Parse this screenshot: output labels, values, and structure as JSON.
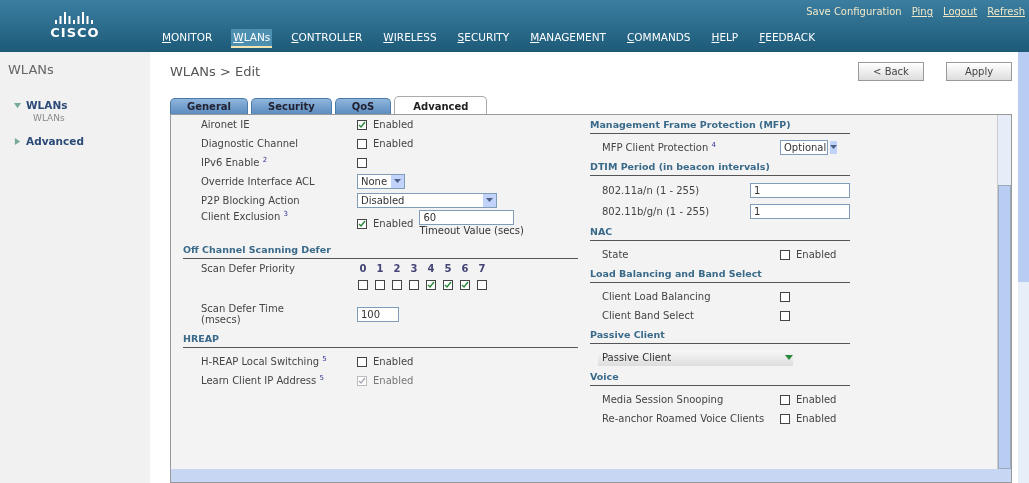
{
  "header": {
    "logo": "CISCO",
    "links": [
      "Save Configuration",
      "Ping",
      "Logout",
      "Refresh"
    ],
    "menu": [
      {
        "label": "MONITOR",
        "selected": false
      },
      {
        "label": "WLANs",
        "selected": true
      },
      {
        "label": "CONTROLLER",
        "selected": false
      },
      {
        "label": "WIRELESS",
        "selected": false
      },
      {
        "label": "SECURITY",
        "selected": false
      },
      {
        "label": "MANAGEMENT",
        "selected": false
      },
      {
        "label": "COMMANDS",
        "selected": false
      },
      {
        "label": "HELP",
        "selected": false
      },
      {
        "label": "FEEDBACK",
        "selected": false
      }
    ]
  },
  "sidebar": {
    "title": "WLANs",
    "items": [
      {
        "label": "WLANs",
        "expanded": true,
        "children": [
          {
            "label": "WLANs"
          }
        ]
      },
      {
        "label": "Advanced",
        "expanded": false
      }
    ]
  },
  "page": {
    "title": "WLANs > Edit",
    "buttons": [
      "< Back",
      "Apply"
    ]
  },
  "tabs": [
    {
      "label": "General",
      "selected": false
    },
    {
      "label": "Security",
      "selected": false
    },
    {
      "label": "QoS",
      "selected": false
    },
    {
      "label": "Advanced",
      "selected": true
    }
  ],
  "left_column": [
    {
      "rows": [
        {
          "kind": "check",
          "label": "Aironet IE",
          "checked": true,
          "disabled": false,
          "text": "Enabled"
        },
        {
          "kind": "check",
          "label": "Diagnostic Channel",
          "checked": false,
          "disabled": false,
          "text": "Enabled"
        },
        {
          "kind": "check",
          "label": "IPv6 Enable $^{2}$",
          "checked": false,
          "disabled": false
        },
        {
          "kind": "select",
          "label": "Override Interface ACL",
          "value": "None"
        },
        {
          "kind": "select",
          "label": "P2P Blocking Action",
          "value": "Disabled",
          "wide": true
        },
        {
          "kind": "timeout",
          "label": "Client Exclusion $^{3}$",
          "checked": true,
          "text": "Enabled",
          "value": "60",
          "hint": "Timeout Value (secs)"
        }
      ]
    },
    {
      "title": "Off Channel Scanning Defer",
      "rows": [
        {
          "kind": "priority",
          "label": "Scan Defer Priority",
          "levels": [
            {
              "label": "0",
              "checked": false
            },
            {
              "label": "1",
              "checked": false
            },
            {
              "label": "2",
              "checked": false
            },
            {
              "label": "3",
              "checked": false
            },
            {
              "label": "4",
              "checked": true
            },
            {
              "label": "5",
              "checked": true
            },
            {
              "label": "6",
              "checked": true
            },
            {
              "label": "7",
              "checked": false
            }
          ]
        },
        {
          "kind": "input",
          "label": "Scan Defer Time",
          "sublabel": "(msecs)",
          "value": "100"
        }
      ]
    },
    {
      "title": "HREAP",
      "rows": [
        {
          "kind": "check",
          "label": "H-REAP Local Switching $^{5}$",
          "checked": false,
          "disabled": false,
          "text": "Enabled"
        },
        {
          "kind": "check",
          "label": "Learn Client IP Address $^{5}$",
          "checked": true,
          "disabled": true,
          "text": "Enabled"
        }
      ]
    }
  ],
  "right_column": [
    {
      "title": "Management Frame Protection (MFP)",
      "rows": [
        {
          "kind": "select",
          "label": "MFP Client Protection $^{4}$",
          "value": "Optional"
        }
      ]
    },
    {
      "title": "DTIM Period (in beacon intervals)",
      "rows": [
        {
          "kind": "input",
          "label": "802.11a/n (1 - 255)",
          "value": "1"
        },
        {
          "kind": "input",
          "label": "802.11b/g/n (1 - 255)",
          "value": "1"
        }
      ]
    },
    {
      "title": "NAC",
      "rows": [
        {
          "kind": "check",
          "label": "State",
          "checked": false,
          "disabled": false,
          "text": "Enabled"
        }
      ]
    },
    {
      "title": "Load Balancing and Band Select",
      "rows": [
        {
          "kind": "check",
          "label": "Client Load Balancing",
          "checked": false,
          "disabled": false
        },
        {
          "kind": "check",
          "label": "Client Band Select",
          "checked": false,
          "disabled": false
        }
      ]
    },
    {
      "title": "Passive Client",
      "rows": [
        {
          "kind": "passive",
          "value": "Passive Client"
        }
      ]
    },
    {
      "title": "Voice",
      "rows": [
        {
          "kind": "check",
          "label": "Media Session Snooping",
          "checked": false,
          "disabled": false,
          "text": "Enabled"
        },
        {
          "kind": "check",
          "label": "Re-anchor Roamed Voice Clients",
          "checked": false,
          "disabled": false,
          "text": "Enabled"
        }
      ]
    }
  ]
}
